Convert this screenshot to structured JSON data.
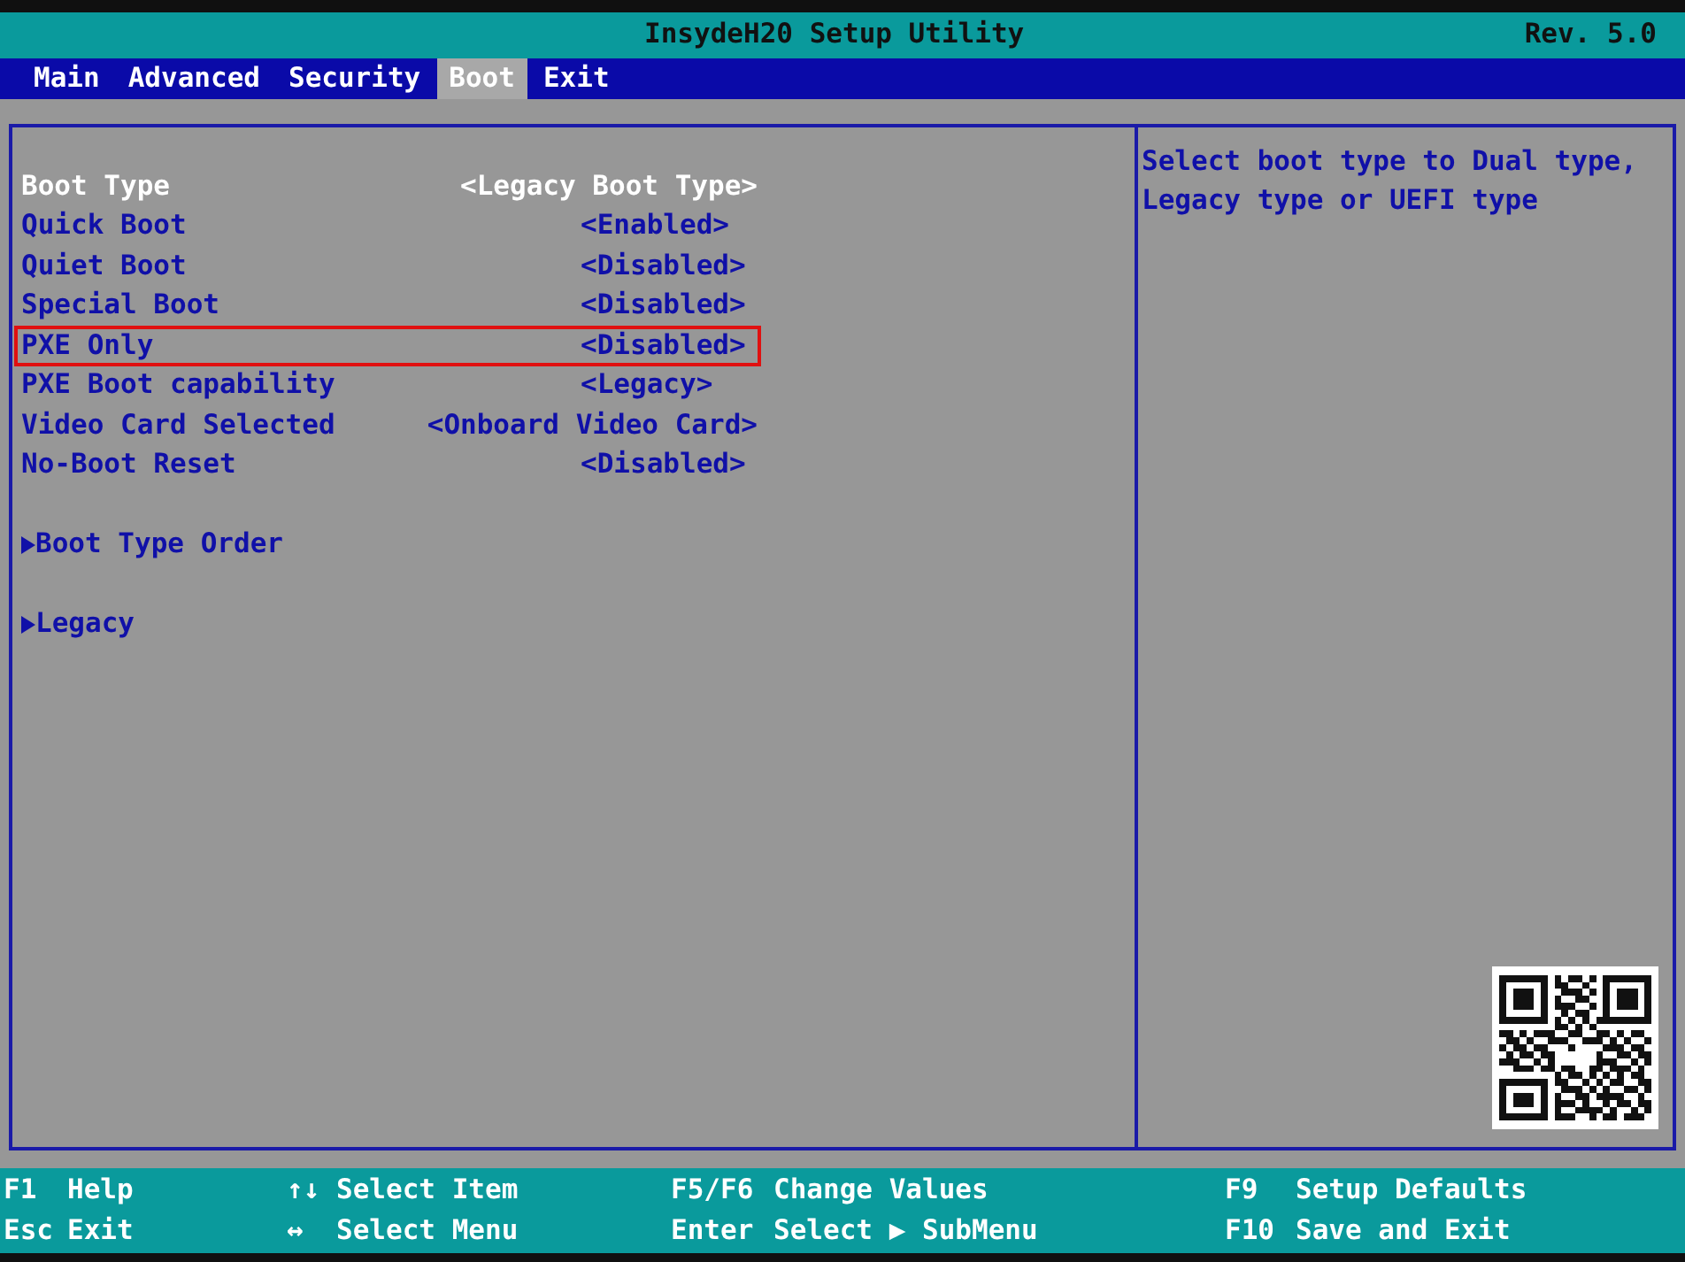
{
  "window": {
    "title": "InsydeH20 Setup Utility",
    "revision": "Rev. 5.0"
  },
  "tabs": [
    {
      "label": "Main",
      "selected": false
    },
    {
      "label": "Advanced",
      "selected": false
    },
    {
      "label": "Security",
      "selected": false
    },
    {
      "label": "Boot",
      "selected": true
    },
    {
      "label": "Exit",
      "selected": false
    }
  ],
  "items": [
    {
      "kind": "setting",
      "label": "Boot Type",
      "value": "<Legacy Boot Type>",
      "selected": true,
      "highlighted": false
    },
    {
      "kind": "setting",
      "label": "Quick Boot",
      "value": "<Enabled>",
      "selected": false,
      "highlighted": false
    },
    {
      "kind": "setting",
      "label": "Quiet Boot",
      "value": "<Disabled>",
      "selected": false,
      "highlighted": false
    },
    {
      "kind": "setting",
      "label": "Special Boot",
      "value": "<Disabled>",
      "selected": false,
      "highlighted": false
    },
    {
      "kind": "setting",
      "label": "PXE Only",
      "value": "<Disabled>",
      "selected": false,
      "highlighted": true
    },
    {
      "kind": "setting",
      "label": "PXE Boot capability",
      "value": "<Legacy>",
      "selected": false,
      "highlighted": false
    },
    {
      "kind": "setting",
      "label": "Video Card Selected",
      "value": "<Onboard Video Card>",
      "selected": false,
      "highlighted": false
    },
    {
      "kind": "setting",
      "label": "No-Boot Reset",
      "value": "<Disabled>",
      "selected": false,
      "highlighted": false
    },
    {
      "kind": "submenu",
      "label": "Boot Type Order",
      "selected": false,
      "highlighted": false
    },
    {
      "kind": "submenu",
      "label": "Legacy",
      "selected": false,
      "highlighted": false
    }
  ],
  "help": {
    "text": "Select boot type to Dual type, Legacy type or UEFI type"
  },
  "footer": [
    [
      {
        "key": "F1",
        "action": "Help"
      },
      {
        "key": "Esc",
        "action": "Exit"
      }
    ],
    [
      {
        "key": "↑↓",
        "action": "Select Item"
      },
      {
        "key": "↔",
        "action": "Select Menu"
      }
    ],
    [
      {
        "key": "F5/F6",
        "action": "Change Values"
      },
      {
        "key": "Enter",
        "action": "Select ▶ SubMenu"
      }
    ],
    [
      {
        "key": "F9",
        "action": "Setup Defaults"
      },
      {
        "key": "F10",
        "action": "Save and Exit"
      }
    ]
  ]
}
